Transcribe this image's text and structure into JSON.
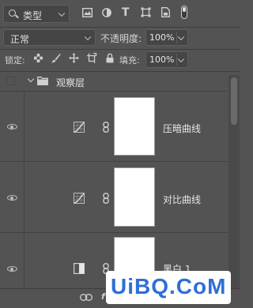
{
  "filter": {
    "kind_label": "类型"
  },
  "blend": {
    "mode": "正常",
    "opacity_label": "不透明度:",
    "opacity_value": "100%"
  },
  "lock_row": {
    "lock_label": "锁定:",
    "fill_label": "填充:",
    "fill_value": "100%"
  },
  "group": {
    "name": "观察层"
  },
  "layers": [
    {
      "name": "压暗曲线",
      "type": "curves"
    },
    {
      "name": "对比曲线",
      "type": "curves"
    },
    {
      "name": "黑白 1",
      "type": "black-white"
    }
  ],
  "watermark": {
    "text": "UiBQ.CoM"
  },
  "colors": {
    "panel_bg": "#535353",
    "control_bg": "#454545",
    "mask_white": "#ffffff",
    "text": "#d4d4d4",
    "watermark_blue": "#2f6fd6"
  }
}
